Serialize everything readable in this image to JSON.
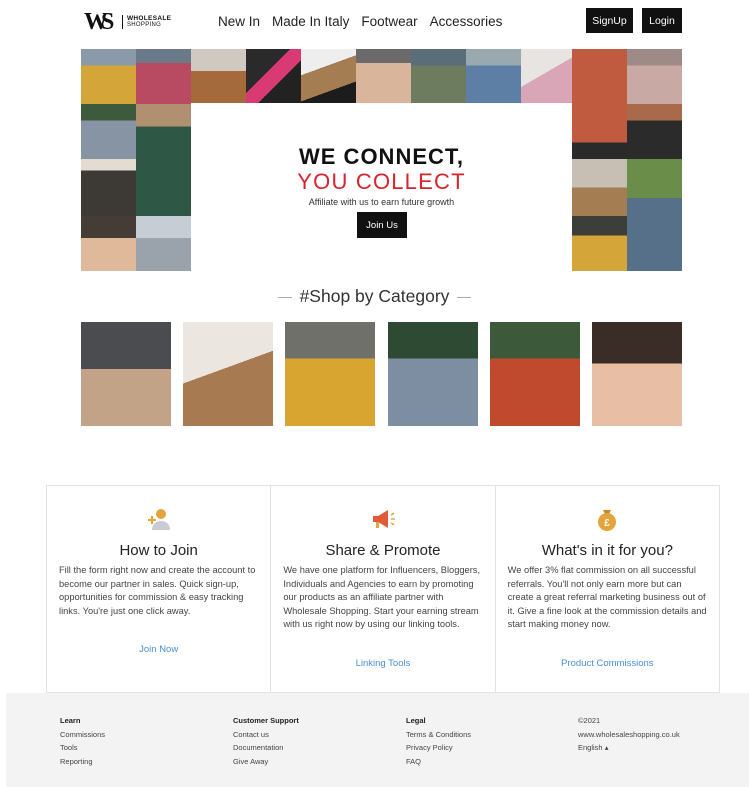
{
  "header": {
    "logo_mark": "WS",
    "logo_line1": "WHOLESALE",
    "logo_line2": "SHOPPING",
    "nav": [
      "New In",
      "Made In Italy",
      "Footwear",
      "Accessories"
    ],
    "signup_label": "SignUp",
    "login_label": "Login"
  },
  "hero": {
    "title_line1": "WE CONNECT,",
    "title_line2": "YOU COLLECT",
    "subtitle": "Affiliate with us to earn future growth",
    "cta_label": "Join Us"
  },
  "shop": {
    "title": "#Shop by Category"
  },
  "cards": [
    {
      "icon": "add-user-icon",
      "title": "How to Join",
      "text": "Fill the form right now and create the account to become our partner in sales. Quick sign-up, opportunities for commission & easy tracking links. You're just one click away.",
      "link": "Join Now"
    },
    {
      "icon": "megaphone-icon",
      "title": "Share & Promote",
      "text": "We have one platform for Influencers, Bloggers, Individuals and Agencies to earn by promoting our products as an affiliate partner with Wholesale Shopping. Start your earning stream with us right now by using our linking tools.",
      "link": "Linking Tools"
    },
    {
      "icon": "money-bag-icon",
      "title": "What's in it for you?",
      "text": "We offer 3% flat commission on all successful referrals. You'll not only earn more but can create a great referral marketing business out of it. Give a fine look at the commission details and start making money now.",
      "link": "Product Commissions"
    }
  ],
  "footer": {
    "learn": {
      "heading": "Learn",
      "items": [
        "Commissions",
        "Tools",
        "Reporting"
      ]
    },
    "support": {
      "heading": "Customer Support",
      "items": [
        "Contact us",
        "Documentation",
        "Give Away"
      ]
    },
    "legal": {
      "heading": "Legal",
      "items": [
        "Terms & Conditions",
        "Privacy Policy",
        "FAQ"
      ]
    },
    "meta": {
      "copyright": "©2021",
      "site": "www.wholesaleshopping.co.uk",
      "language": "English"
    }
  },
  "colors": {
    "accent_red": "#d9232d",
    "link_blue": "#4a8fd6",
    "icon_gold": "#e3a43c"
  }
}
